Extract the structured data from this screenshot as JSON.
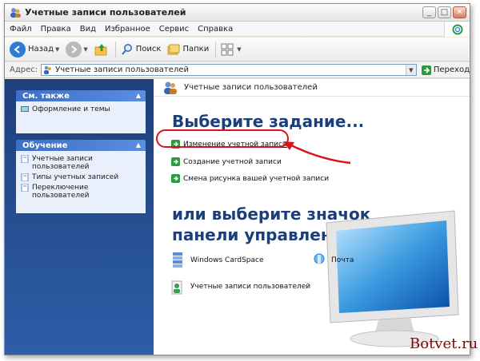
{
  "window": {
    "title": "Учетные записи пользователей"
  },
  "menu": [
    "Файл",
    "Правка",
    "Вид",
    "Избранное",
    "Сервис",
    "Справка"
  ],
  "toolbar": {
    "back": "Назад",
    "search": "Поиск",
    "folders": "Папки"
  },
  "address": {
    "label": "Адрес:",
    "value": "Учетные записи пользователей",
    "go": "Переход"
  },
  "left": {
    "see_also": {
      "title": "См. также",
      "items": [
        "Оформление и темы"
      ]
    },
    "learn": {
      "title": "Обучение",
      "items": [
        "Учетные записи пользователей",
        "Типы учетных записей",
        "Переключение пользователей"
      ]
    }
  },
  "main": {
    "header": "Учетные записи пользователей",
    "task_title": "Выберите задание...",
    "tasks": [
      "Изменение учетной записи",
      "Создание учетной записи",
      "Смена рисунка вашей учетной записи"
    ],
    "or_title": "или выберите значок панели управления",
    "icons": [
      "Windows CardSpace",
      "Почта",
      "Учетные записи пользователей"
    ]
  },
  "watermark": "Botvet.ru",
  "colors": {
    "accent_blue": "#1b3f78",
    "left_pane": "#2e5ea8",
    "highlight_red": "#d8141a"
  }
}
